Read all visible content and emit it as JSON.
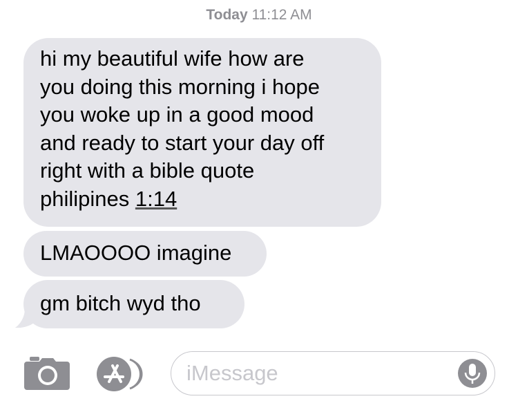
{
  "timestamp": {
    "day": "Today",
    "time": "11:12 AM"
  },
  "messages": [
    {
      "lines": [
        "hi my beautiful wife how are",
        "you doing this morning i hope",
        "you woke up in a good mood",
        "and ready to start your day off",
        "right with a bible quote"
      ],
      "last_line_prefix": "philipines ",
      "last_line_link": "1:14"
    },
    {
      "text": "LMAOOOO imagine"
    },
    {
      "text": "gm bitch wyd tho"
    }
  ],
  "composer": {
    "placeholder": "iMessage",
    "value": ""
  },
  "icons": {
    "camera": "camera-icon",
    "apps": "app-store-icon",
    "mic": "microphone-icon"
  },
  "colors": {
    "bubble": "#e5e5ea",
    "timestamp": "#8e8e93",
    "icon": "#8e8e93",
    "placeholder": "#c7c7cc"
  }
}
